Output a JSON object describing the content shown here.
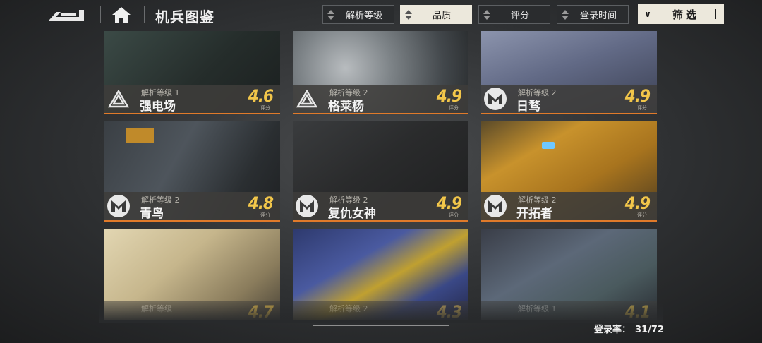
{
  "header": {
    "title": "机兵图鉴",
    "back_icon": "back-arrow-icon",
    "home_icon": "home-icon",
    "sort_buttons": [
      {
        "label": "解析等级",
        "active": false
      },
      {
        "label": "品质",
        "active": true
      },
      {
        "label": "评分",
        "active": false
      },
      {
        "label": "登录时间",
        "active": false
      }
    ],
    "filter_label": "筛选"
  },
  "cards": [
    {
      "level": "解析等级 1",
      "name": "强电场",
      "score": "4.6",
      "score_label": "评分",
      "logo": "triangle-faction-icon",
      "art_color": "#2f3b38"
    },
    {
      "level": "解析等级 2",
      "name": "格莱杨",
      "score": "4.9",
      "score_label": "评分",
      "logo": "triangle-faction-icon",
      "art_color": "#6b6f72"
    },
    {
      "level": "解析等级 2",
      "name": "日骛",
      "score": "4.9",
      "score_label": "评分",
      "logo": "m-faction-icon",
      "art_color": "#6c7590"
    },
    {
      "level": "解析等级 2",
      "name": "青鸟",
      "score": "4.8",
      "score_label": "评分",
      "logo": "m-faction-icon",
      "art_color": "#3c4249"
    },
    {
      "level": "解析等级 2",
      "name": "复仇女神",
      "score": "4.9",
      "score_label": "评分",
      "logo": "m-faction-icon",
      "art_color": "#2e3032"
    },
    {
      "level": "解析等级 2",
      "name": "开拓者",
      "score": "4.9",
      "score_label": "评分",
      "logo": "m-faction-icon",
      "art_color": "#c28a2a"
    },
    {
      "level": "解析等级",
      "name": "",
      "score": "4.7",
      "score_label": "",
      "logo": "",
      "art_color": "#cdbf9a"
    },
    {
      "level": "解析等级 2",
      "name": "",
      "score": "4.3",
      "score_label": "",
      "logo": "",
      "art_color": "#3f4f8c"
    },
    {
      "level": "解析等级 1",
      "name": "",
      "score": "4.1",
      "score_label": "",
      "logo": "",
      "art_color": "#5a6368"
    }
  ],
  "footer": {
    "collect_label": "登录率：",
    "collect_value": "31/72"
  }
}
